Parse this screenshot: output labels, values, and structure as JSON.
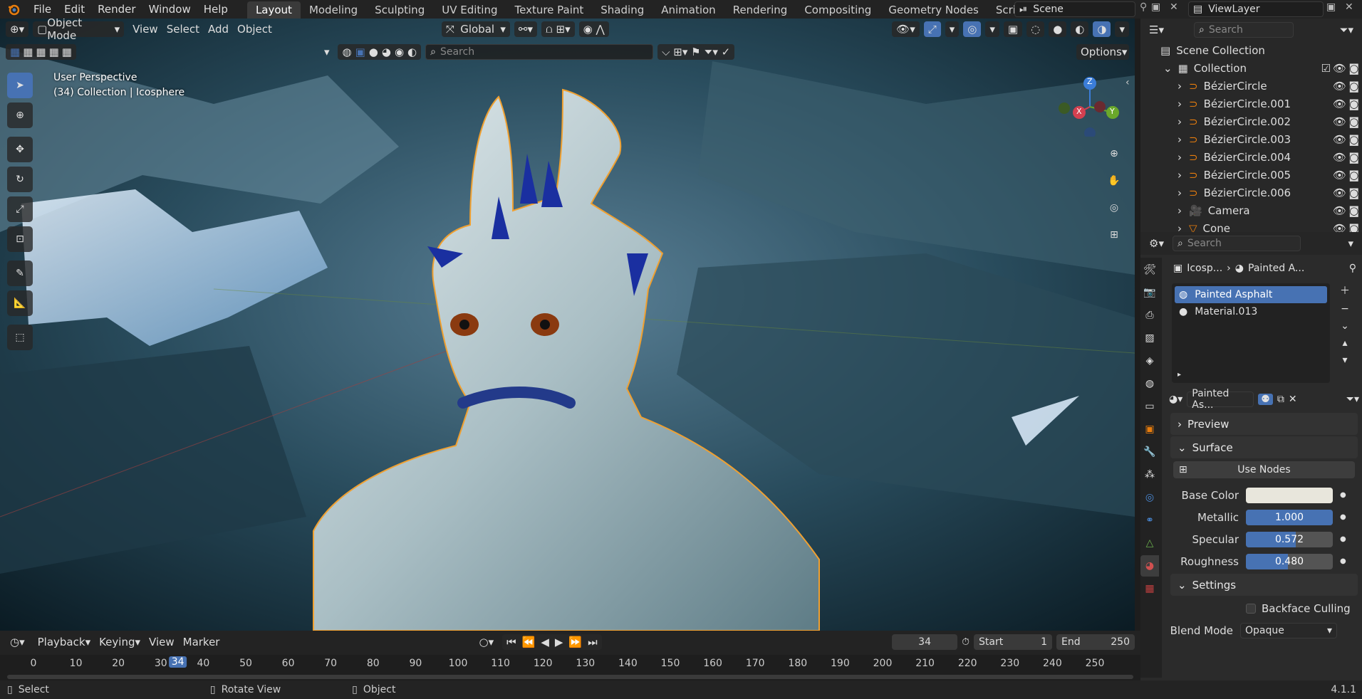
{
  "topbar": {
    "menus": [
      "File",
      "Edit",
      "Render",
      "Window",
      "Help"
    ],
    "workspaces": [
      "Layout",
      "Modeling",
      "Sculpting",
      "UV Editing",
      "Texture Paint",
      "Shading",
      "Animation",
      "Rendering",
      "Compositing",
      "Geometry Nodes",
      "Scripting"
    ],
    "active_workspace": "Layout",
    "scene": "Scene",
    "view_layer": "ViewLayer"
  },
  "viewport": {
    "mode": "Object Mode",
    "menus": [
      "View",
      "Select",
      "Add",
      "Object"
    ],
    "orientation": "Global",
    "search_placeholder": "Search",
    "options": "Options",
    "overlay_line1": "User Perspective",
    "overlay_line2": "(34) Collection | Icosphere",
    "gizmo_axes": {
      "z": "Z",
      "x": "X",
      "y": "Y"
    }
  },
  "outliner": {
    "search_placeholder": "Search",
    "scene_collection": "Scene Collection",
    "collection": "Collection",
    "items": [
      "BézierCircle",
      "BézierCircle.001",
      "BézierCircle.002",
      "BézierCircle.003",
      "BézierCircle.004",
      "BézierCircle.005",
      "BézierCircle.006",
      "Camera",
      "Cone"
    ]
  },
  "properties": {
    "search_placeholder": "Search",
    "breadcrumb_object": "Icosp...",
    "breadcrumb_material": "Painted A...",
    "slots": [
      "Painted Asphalt",
      "Material.013"
    ],
    "active_slot": "Painted Asphalt",
    "material_name": "Painted As...",
    "panels": {
      "preview": "Preview",
      "surface": "Surface",
      "settings": "Settings"
    },
    "use_nodes": "Use Nodes",
    "base_color_label": "Base Color",
    "base_color": "#e8e6dc",
    "sliders": [
      {
        "label": "Metallic",
        "value": "1.000",
        "fraction": 1.0
      },
      {
        "label": "Specular",
        "value": "0.572",
        "fraction": 0.572
      },
      {
        "label": "Roughness",
        "value": "0.480",
        "fraction": 0.48
      }
    ],
    "backface_culling": "Backface Culling",
    "blend_mode_label": "Blend Mode",
    "blend_mode": "Opaque"
  },
  "timeline": {
    "menus": [
      "Playback",
      "Keying",
      "View",
      "Marker"
    ],
    "current_frame": "34",
    "start_label": "Start",
    "start": "1",
    "end_label": "End",
    "end": "250",
    "ticks": [
      "0",
      "10",
      "20",
      "30",
      "40",
      "50",
      "60",
      "70",
      "80",
      "90",
      "100",
      "110",
      "120",
      "130",
      "140",
      "150",
      "160",
      "170",
      "180",
      "190",
      "200",
      "210",
      "220",
      "230",
      "240",
      "250"
    ]
  },
  "status": {
    "select": "Select",
    "rotate": "Rotate View",
    "object": "Object",
    "version": "4.1.1"
  },
  "colors": {
    "accent": "#4772b3",
    "selection_outline": "#f0a030",
    "bg_panel": "#2b2b2b"
  }
}
